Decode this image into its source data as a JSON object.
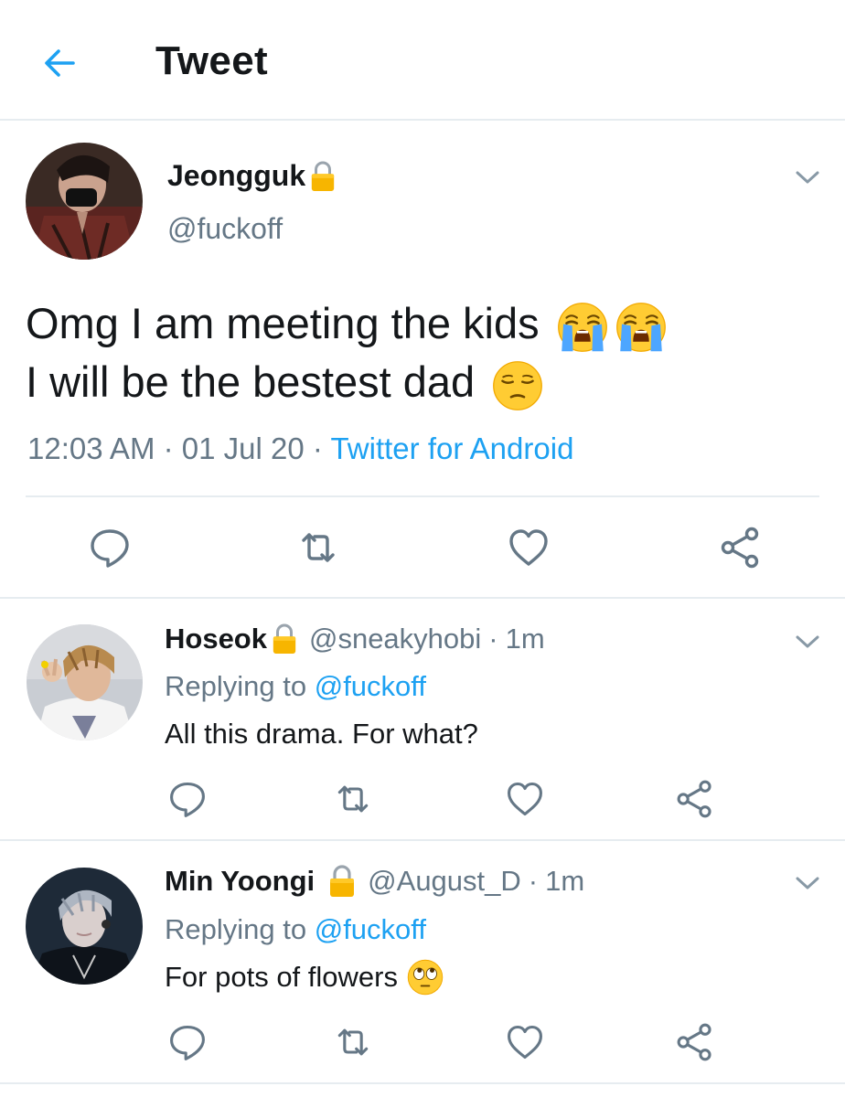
{
  "header": {
    "title": "Tweet",
    "back_icon": "arrow-left-icon"
  },
  "colors": {
    "accent": "#1da1f2",
    "muted": "#657786",
    "text": "#14171a",
    "divider": "#e6ecf0",
    "lock": "#f7b500"
  },
  "main_tweet": {
    "name": "Jeongguk",
    "handle": "@fuckoff",
    "text_line1": "Omg I am meeting the kids",
    "text_line2": "I will be the bestest dad",
    "emojis_line1": [
      "loudly-crying-face",
      "loudly-crying-face"
    ],
    "emojis_line2": [
      "pensive-face"
    ],
    "time": "12:03 AM",
    "date": "01 Jul 20",
    "source": "Twitter for Android",
    "separator": "·"
  },
  "replies": [
    {
      "name": "Hoseok",
      "handle": "@sneakyhobi",
      "age": "1m",
      "replying_label": "Replying to",
      "replying_to": "@fuckoff",
      "text": "All this drama. For what?"
    },
    {
      "name": "Min Yoongi",
      "handle": "@August_D",
      "age": "1m",
      "replying_label": "Replying to",
      "replying_to": "@fuckoff",
      "text": "For pots of flowers",
      "emoji": "face-with-rolling-eyes"
    }
  ],
  "actions": [
    "reply-icon",
    "retweet-icon",
    "like-icon",
    "share-icon"
  ]
}
